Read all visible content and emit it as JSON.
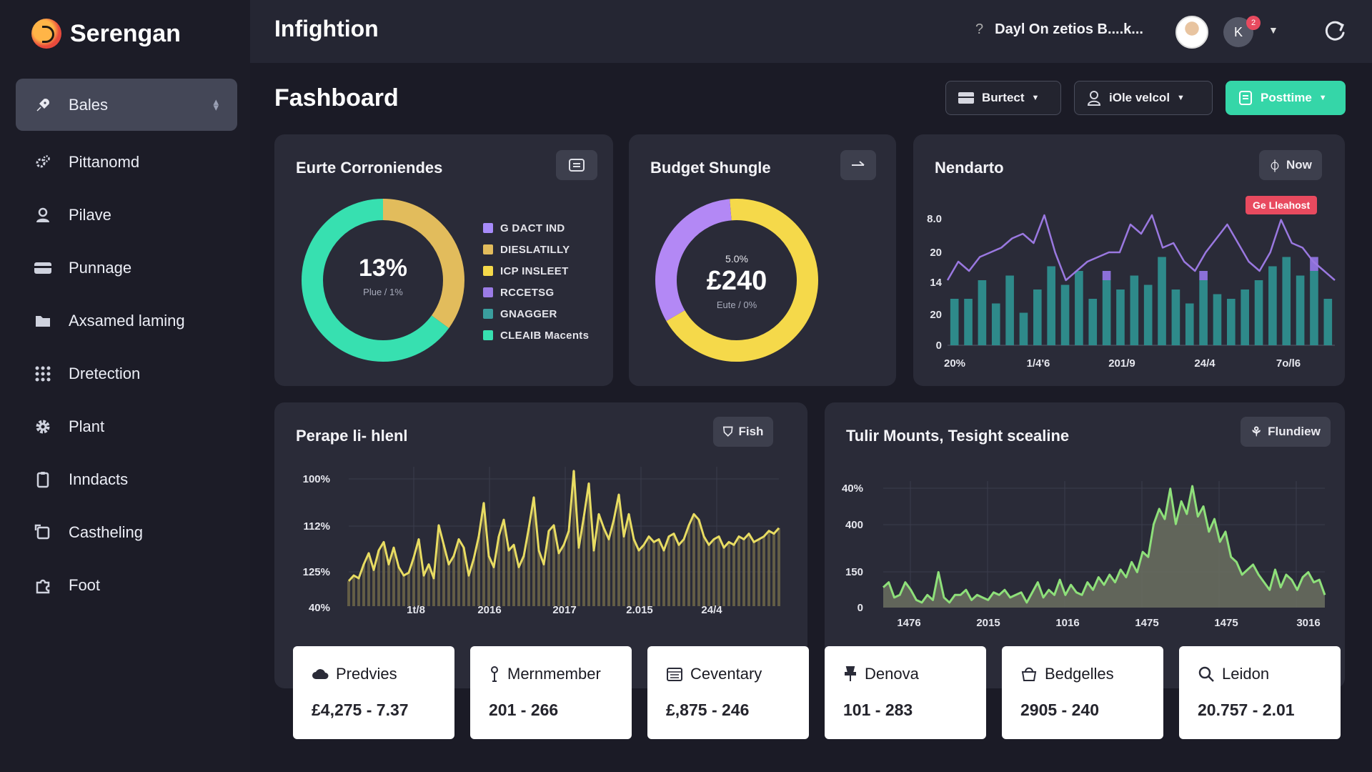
{
  "brand": {
    "name": "Serengan"
  },
  "header": {
    "app_title": "Infightion",
    "search_text": "Dayl On zetios B....k...",
    "search_prefix": "?",
    "user_initials": "K",
    "notification_count": "2"
  },
  "sidebar": {
    "items": [
      {
        "label": "Bales",
        "icon": "rocket-icon",
        "active": true
      },
      {
        "label": "Pittanomd",
        "icon": "gears-icon"
      },
      {
        "label": "Pilave",
        "icon": "user-icon"
      },
      {
        "label": "Punnage",
        "icon": "card-icon"
      },
      {
        "label": "Axsamed laming",
        "icon": "folder-icon"
      },
      {
        "label": "Dretection",
        "icon": "grid-icon"
      },
      {
        "label": "Plant",
        "icon": "gear-icon"
      },
      {
        "label": "Inndacts",
        "icon": "clipboard-icon"
      },
      {
        "label": "Castheling",
        "icon": "frame-icon"
      },
      {
        "label": "Foot",
        "icon": "puzzle-icon"
      }
    ]
  },
  "main": {
    "page_title": "Fashboard",
    "buttons": {
      "burtect": "Burtect",
      "vieleol": "iOle velcol",
      "posttime": "Posttime"
    }
  },
  "cards": {
    "conroniendes": {
      "title": "Eurte Corroniendes",
      "center_value": "13%",
      "center_sub": "Plue / 1%",
      "legend": [
        {
          "label": "G DACT IND",
          "color": "#a78bfa"
        },
        {
          "label": "DIESLATILLY",
          "color": "#e2bc5c"
        },
        {
          "label": "ICP INSLEET",
          "color": "#f5d94a"
        },
        {
          "label": "RCCETSG",
          "color": "#9b7be6"
        },
        {
          "label": "GNAGGER",
          "color": "#3a9e9e"
        },
        {
          "label": "CLEAIB Macents",
          "color": "#37e0b0"
        }
      ]
    },
    "budget": {
      "title": "Budget Shungle",
      "center_top": "5.0%",
      "center_value": "£240",
      "center_sub": "Eute / 0%"
    },
    "nendarto": {
      "title": "Nendarto",
      "now_label": "Now",
      "badge": "Ge Lleahost"
    },
    "perape": {
      "title": "Perape li- hlenl",
      "button": "Fish"
    },
    "tulir": {
      "title": "Tulir Mounts, Tesight scealine",
      "button": "Flundiew"
    }
  },
  "stats": [
    {
      "label": "Predvies",
      "value": "£4,275 - 7.37",
      "icon": "cloud-icon"
    },
    {
      "label": "Mernmember",
      "value": "201 - 266",
      "icon": "pin-icon"
    },
    {
      "label": "Ceventary",
      "value": "£,875 - 246",
      "icon": "calendar-icon"
    },
    {
      "label": "Denova",
      "value": "101 - 283",
      "icon": "pushpin-icon"
    },
    {
      "label": "Bedgelles",
      "value": "2905 - 240",
      "icon": "bucket-icon"
    },
    {
      "label": "Leidon",
      "value": "20.757 - 2.01",
      "icon": "search-icon"
    }
  ],
  "chart_data": [
    {
      "type": "pie",
      "title": "Eurte Corroniendes",
      "categories": [
        "G DACT IND",
        "DIESLATILLY",
        "ICP INSLEET",
        "RCCETSG",
        "GNAGGER",
        "CLEAIB Macents"
      ],
      "values": [
        0,
        35,
        0,
        0,
        0,
        65
      ],
      "colors": [
        "#a78bfa",
        "#e2bc5c",
        "#f5d94a",
        "#9b7be6",
        "#3a9e9e",
        "#37e0b0"
      ]
    },
    {
      "type": "pie",
      "title": "Budget Shungle",
      "values": [
        68,
        32
      ],
      "colors": [
        "#f5d94a",
        "#b388f5"
      ]
    },
    {
      "type": "bar",
      "title": "Nendarto",
      "x_ticks": [
        "20%",
        "1/4'6",
        "201/9",
        "24/4",
        "7o/l6"
      ],
      "y_ticks": [
        "0",
        "20",
        "14",
        "20",
        "8.0"
      ],
      "bars": [
        10,
        10,
        14,
        9,
        15,
        7,
        12,
        17,
        13,
        16,
        10,
        14,
        12,
        15,
        13,
        19,
        12,
        9,
        14,
        11,
        10,
        12,
        14,
        17,
        19,
        15,
        16,
        10
      ],
      "bar_caps": [
        0,
        0,
        0,
        0,
        0,
        0,
        0,
        0,
        0,
        0,
        0,
        2,
        0,
        0,
        0,
        0,
        0,
        0,
        2,
        0,
        0,
        0,
        0,
        0,
        0,
        0,
        3,
        0
      ],
      "series": [
        {
          "name": "line",
          "values": [
            14,
            18,
            16,
            19,
            20,
            21,
            23,
            24,
            22,
            28,
            20,
            14,
            16,
            18,
            19,
            20,
            20,
            26,
            24,
            28,
            21,
            22,
            18,
            16,
            20,
            23,
            26,
            22,
            18,
            16,
            20,
            27,
            22,
            21,
            18,
            16,
            14
          ]
        }
      ],
      "colors": {
        "bar": "#2e8a8a",
        "cap": "#8b70d8",
        "line": "#9a78e0"
      }
    },
    {
      "type": "line",
      "title": "Perape li- hlenl",
      "x_ticks": [
        "1t/8",
        "2016",
        "2017",
        "2.015",
        "24/4"
      ],
      "y_ticks": [
        "40%",
        "125%",
        "112%",
        "100%"
      ],
      "series": [
        {
          "name": "line",
          "values": [
            18,
            22,
            20,
            30,
            38,
            26,
            40,
            46,
            30,
            42,
            28,
            22,
            24,
            35,
            48,
            22,
            30,
            20,
            58,
            44,
            30,
            36,
            48,
            42,
            22,
            34,
            50,
            74,
            36,
            28,
            50,
            62,
            40,
            44,
            28,
            36,
            56,
            78,
            40,
            30,
            54,
            58,
            38,
            44,
            54,
            97,
            42,
            64,
            88,
            40,
            66,
            56,
            48,
            62,
            80,
            50,
            66,
            48,
            40,
            44,
            50,
            46,
            48,
            40,
            50,
            52,
            44,
            48,
            58,
            66,
            62,
            50,
            44,
            48,
            50,
            42,
            46,
            44,
            50,
            48,
            52,
            46,
            48,
            50,
            54,
            52,
            56
          ]
        }
      ],
      "colors": {
        "line": "#e8dc62",
        "fill": "#6b6448"
      }
    },
    {
      "type": "area",
      "title": "Tulir Mounts, Tesight scealine",
      "x_ticks": [
        "1476",
        "2015",
        "1016",
        "1475",
        "1475",
        "3016"
      ],
      "y_ticks": [
        "0",
        "150",
        "400",
        "40%"
      ],
      "series": [
        {
          "name": "area",
          "values": [
            16,
            20,
            8,
            10,
            20,
            14,
            6,
            4,
            10,
            6,
            28,
            8,
            4,
            10,
            10,
            14,
            6,
            10,
            8,
            6,
            12,
            10,
            14,
            8,
            10,
            12,
            4,
            12,
            20,
            8,
            14,
            10,
            22,
            10,
            18,
            12,
            10,
            20,
            14,
            24,
            18,
            26,
            20,
            30,
            24,
            36,
            28,
            44,
            40,
            66,
            78,
            70,
            94,
            66,
            84,
            74,
            96,
            72,
            80,
            60,
            70,
            52,
            60,
            40,
            36,
            26,
            30,
            34,
            26,
            20,
            14,
            30,
            16,
            26,
            22,
            14,
            24,
            28,
            20,
            22,
            10
          ]
        }
      ],
      "colors": {
        "line": "#8ee07a",
        "fill": "#6b7060"
      }
    }
  ]
}
